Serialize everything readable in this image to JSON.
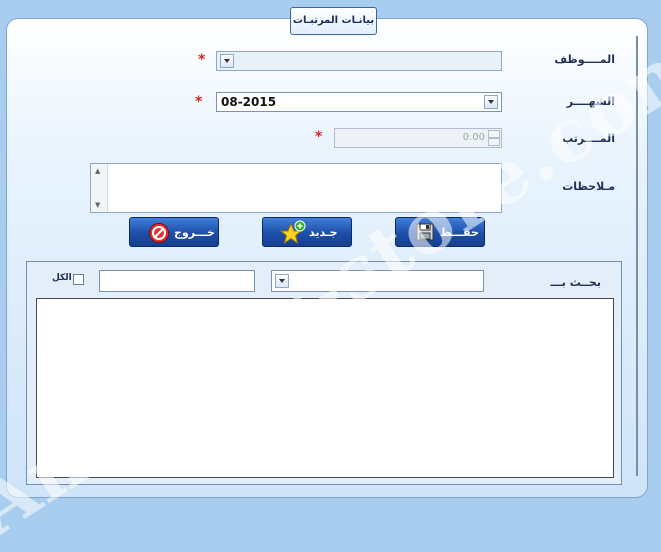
{
  "form": {
    "title": "بيانـات المرتبـات",
    "employee_label": "المــــوظف",
    "month_label": "الشهــــر",
    "month_value": "08-2015",
    "salary_label": "المــــرتب",
    "salary_value": "0.00",
    "notes_label": "مـلاحظات",
    "required_mark": "*"
  },
  "buttons": {
    "save_label": "حفـــظ",
    "new_label": "جـديد",
    "exit_label": "خـــروج"
  },
  "search": {
    "label": "بحــث بـــ",
    "all_label": "الكل"
  },
  "watermark": "Amadeus-store.com",
  "colors": {
    "background": "#a9cdee",
    "button": "#1d4ea8",
    "required": "#e02020"
  }
}
